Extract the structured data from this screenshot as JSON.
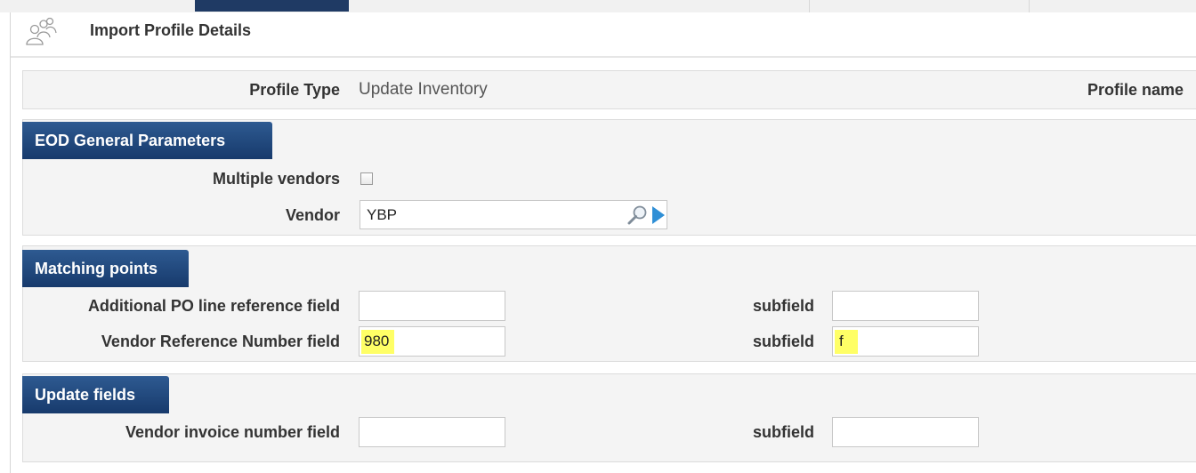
{
  "header": {
    "title": "Import Profile Details",
    "icon": "users-icon"
  },
  "profile": {
    "type_label": "Profile Type",
    "type_value": "Update Inventory",
    "name_label": "Profile name"
  },
  "eod": {
    "title": "EOD General Parameters",
    "multiple_vendors_label": "Multiple vendors",
    "multiple_vendors_checked": false,
    "vendor_label": "Vendor",
    "vendor_value": "YBP"
  },
  "matching": {
    "title": "Matching points",
    "rows": [
      {
        "label": "Additional PO line reference field",
        "field_value": "",
        "subfield_label": "subfield",
        "subfield_value": ""
      },
      {
        "label": "Vendor Reference Number field",
        "field_value": "980",
        "subfield_label": "subfield",
        "subfield_value": "f"
      }
    ]
  },
  "update": {
    "title": "Update fields",
    "rows": [
      {
        "label": "Vendor invoice number field",
        "field_value": "",
        "subfield_label": "subfield",
        "subfield_value": ""
      }
    ]
  },
  "colors": {
    "section_header": "#1f3f70",
    "highlight": "#ffff66",
    "panel_bg": "#f4f4f4"
  }
}
